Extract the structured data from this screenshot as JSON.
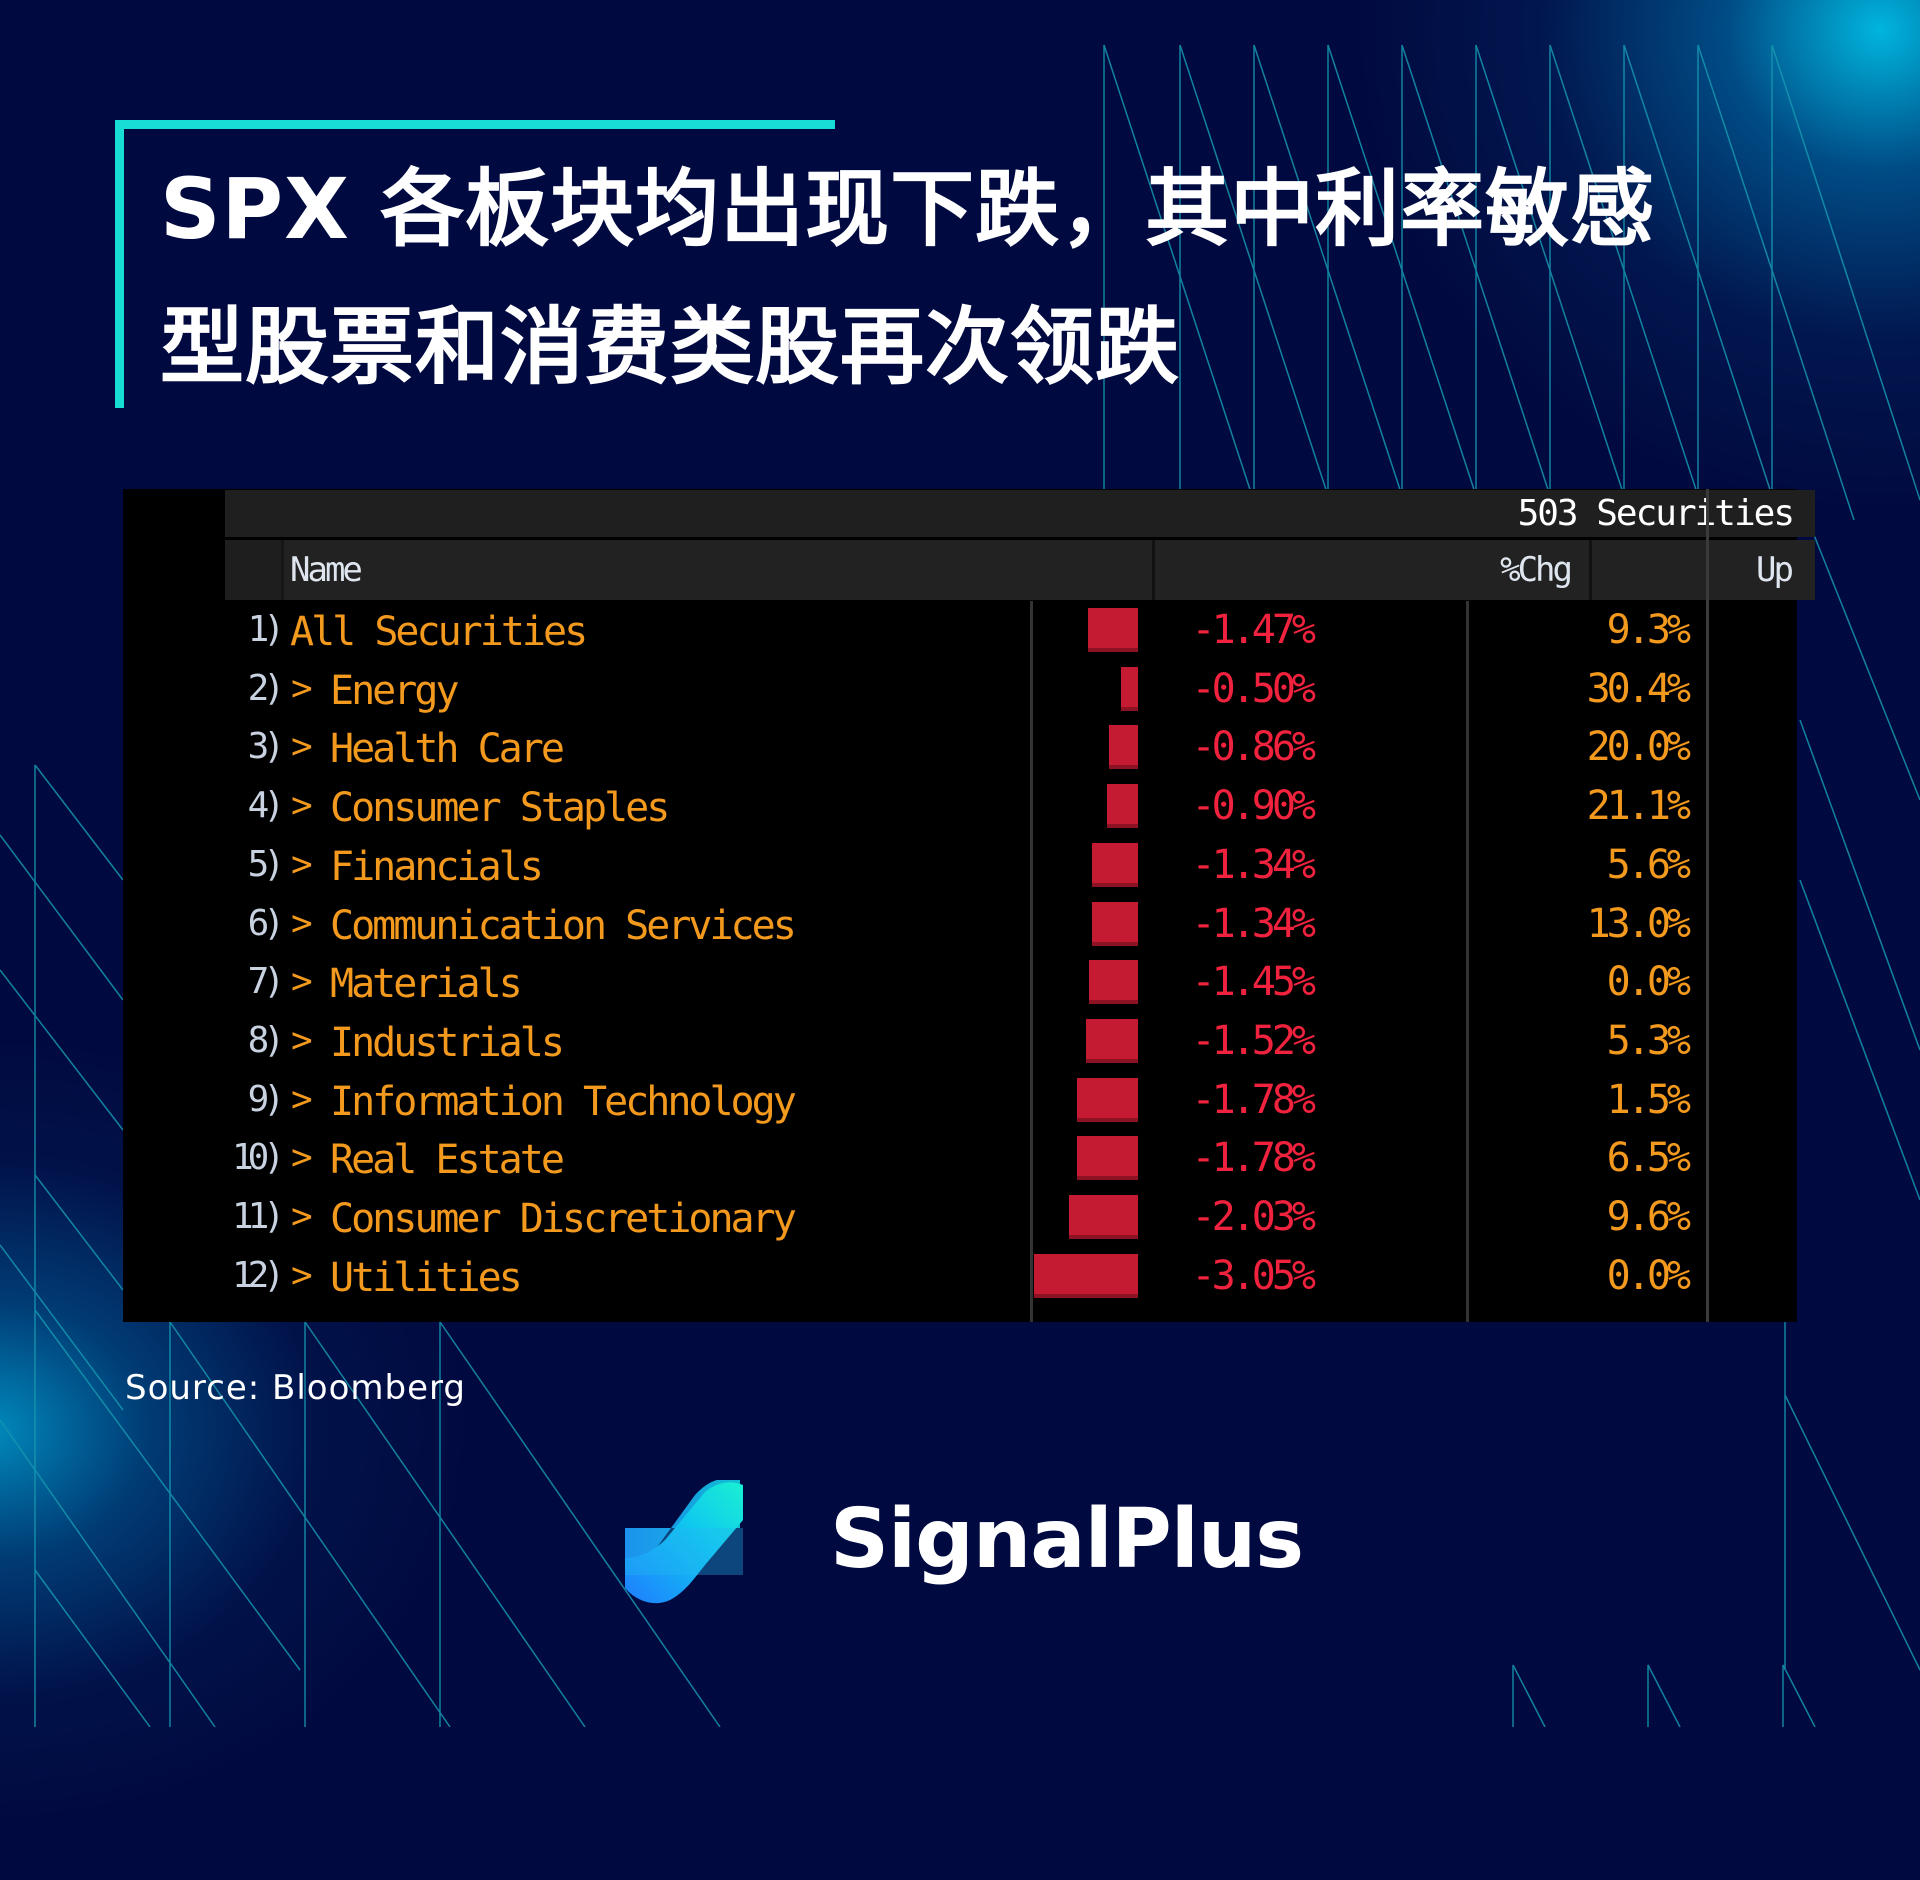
{
  "title": {
    "line1": "SPX 各板块均出现下跌，其中利率敏感",
    "line2": "型股票和消费类股再次领跌"
  },
  "table": {
    "securities_count": "503 Securities",
    "columns": {
      "name": "Name",
      "chg": "%Chg",
      "up": "Up"
    },
    "rows": [
      {
        "num": "1)",
        "chevron": "",
        "name": "All Securities",
        "chg": "-1.47%",
        "chg_value": -1.47,
        "up": "9.3%"
      },
      {
        "num": "2)",
        "chevron": ">",
        "name": "Energy",
        "chg": "-0.50%",
        "chg_value": -0.5,
        "up": "30.4%"
      },
      {
        "num": "3)",
        "chevron": ">",
        "name": "Health Care",
        "chg": "-0.86%",
        "chg_value": -0.86,
        "up": "20.0%"
      },
      {
        "num": "4)",
        "chevron": ">",
        "name": "Consumer Staples",
        "chg": "-0.90%",
        "chg_value": -0.9,
        "up": "21.1%"
      },
      {
        "num": "5)",
        "chevron": ">",
        "name": "Financials",
        "chg": "-1.34%",
        "chg_value": -1.34,
        "up": "5.6%"
      },
      {
        "num": "6)",
        "chevron": ">",
        "name": "Communication Services",
        "chg": "-1.34%",
        "chg_value": -1.34,
        "up": "13.0%"
      },
      {
        "num": "7)",
        "chevron": ">",
        "name": "Materials",
        "chg": "-1.45%",
        "chg_value": -1.45,
        "up": "0.0%"
      },
      {
        "num": "8)",
        "chevron": ">",
        "name": "Industrials",
        "chg": "-1.52%",
        "chg_value": -1.52,
        "up": "5.3%"
      },
      {
        "num": "9)",
        "chevron": ">",
        "name": "Information Technology",
        "chg": "-1.78%",
        "chg_value": -1.78,
        "up": "1.5%"
      },
      {
        "num": "10)",
        "chevron": ">",
        "name": "Real Estate",
        "chg": "-1.78%",
        "chg_value": -1.78,
        "up": "6.5%"
      },
      {
        "num": "11)",
        "chevron": ">",
        "name": "Consumer Discretionary",
        "chg": "-2.03%",
        "chg_value": -2.03,
        "up": "9.6%"
      },
      {
        "num": "12)",
        "chevron": ">",
        "name": "Utilities",
        "chg": "-3.05%",
        "chg_value": -3.05,
        "up": "0.0%"
      }
    ]
  },
  "source": "Source: Bloomberg",
  "brand": {
    "name": "SignalPlus",
    "logo_icon": "signalplus-logo-icon"
  },
  "colors": {
    "background": "#010a40",
    "accent": "#18dcd6",
    "negative": "#f0223d",
    "bar": "#c41a32",
    "label": "#f39a1e"
  }
}
